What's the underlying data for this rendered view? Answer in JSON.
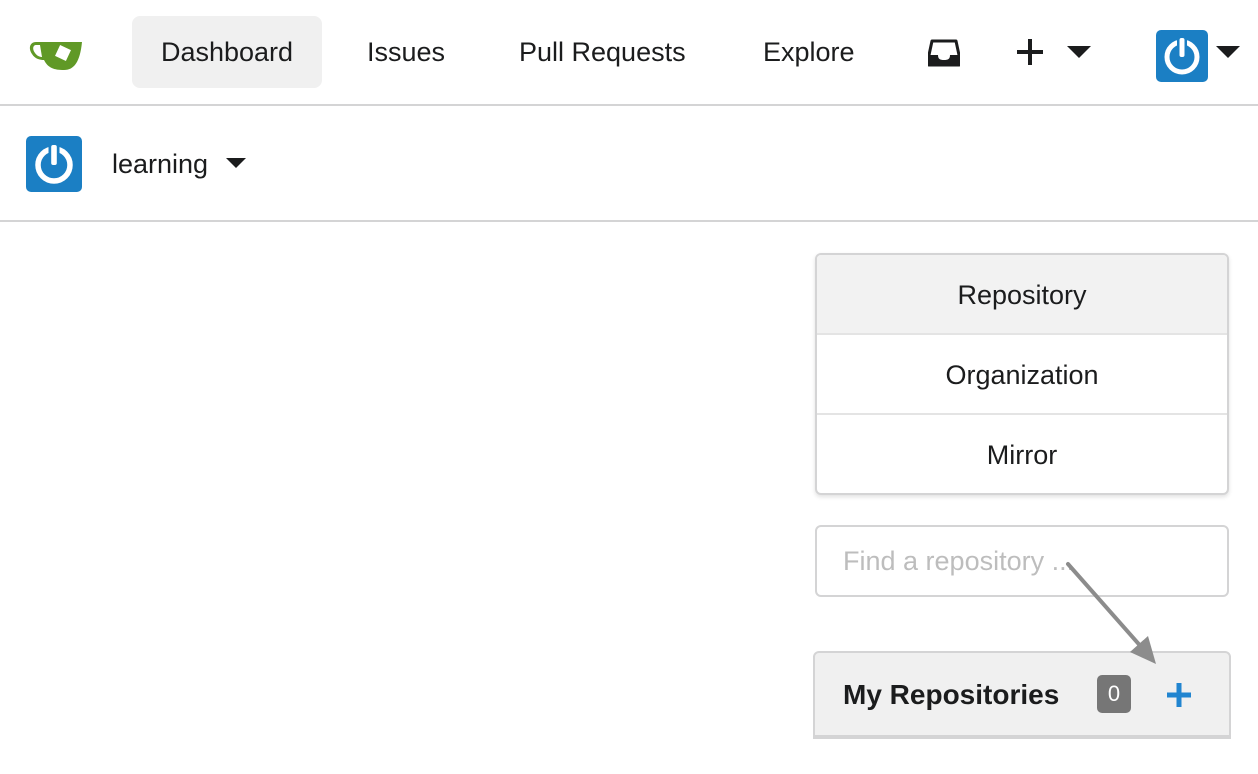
{
  "nav": {
    "logo_icon": "gitea-tea-cup-icon",
    "items": [
      {
        "label": "Dashboard",
        "active": true
      },
      {
        "label": "Issues"
      },
      {
        "label": "Pull Requests"
      },
      {
        "label": "Explore"
      }
    ],
    "inbox_icon": "inbox-icon",
    "create_icon": "plus-icon",
    "user_avatar_icon": "power-avatar-icon"
  },
  "context": {
    "name": "learning"
  },
  "new_menu": {
    "items": [
      "Repository",
      "Organization",
      "Mirror"
    ]
  },
  "search": {
    "placeholder": "Find a repository ..."
  },
  "repositories": {
    "title": "My Repositories",
    "count": "0"
  },
  "colors": {
    "accent": "#1b7fc4",
    "logo_green": "#609926",
    "add_blue": "#2185d0",
    "badge_gray": "#767676"
  }
}
